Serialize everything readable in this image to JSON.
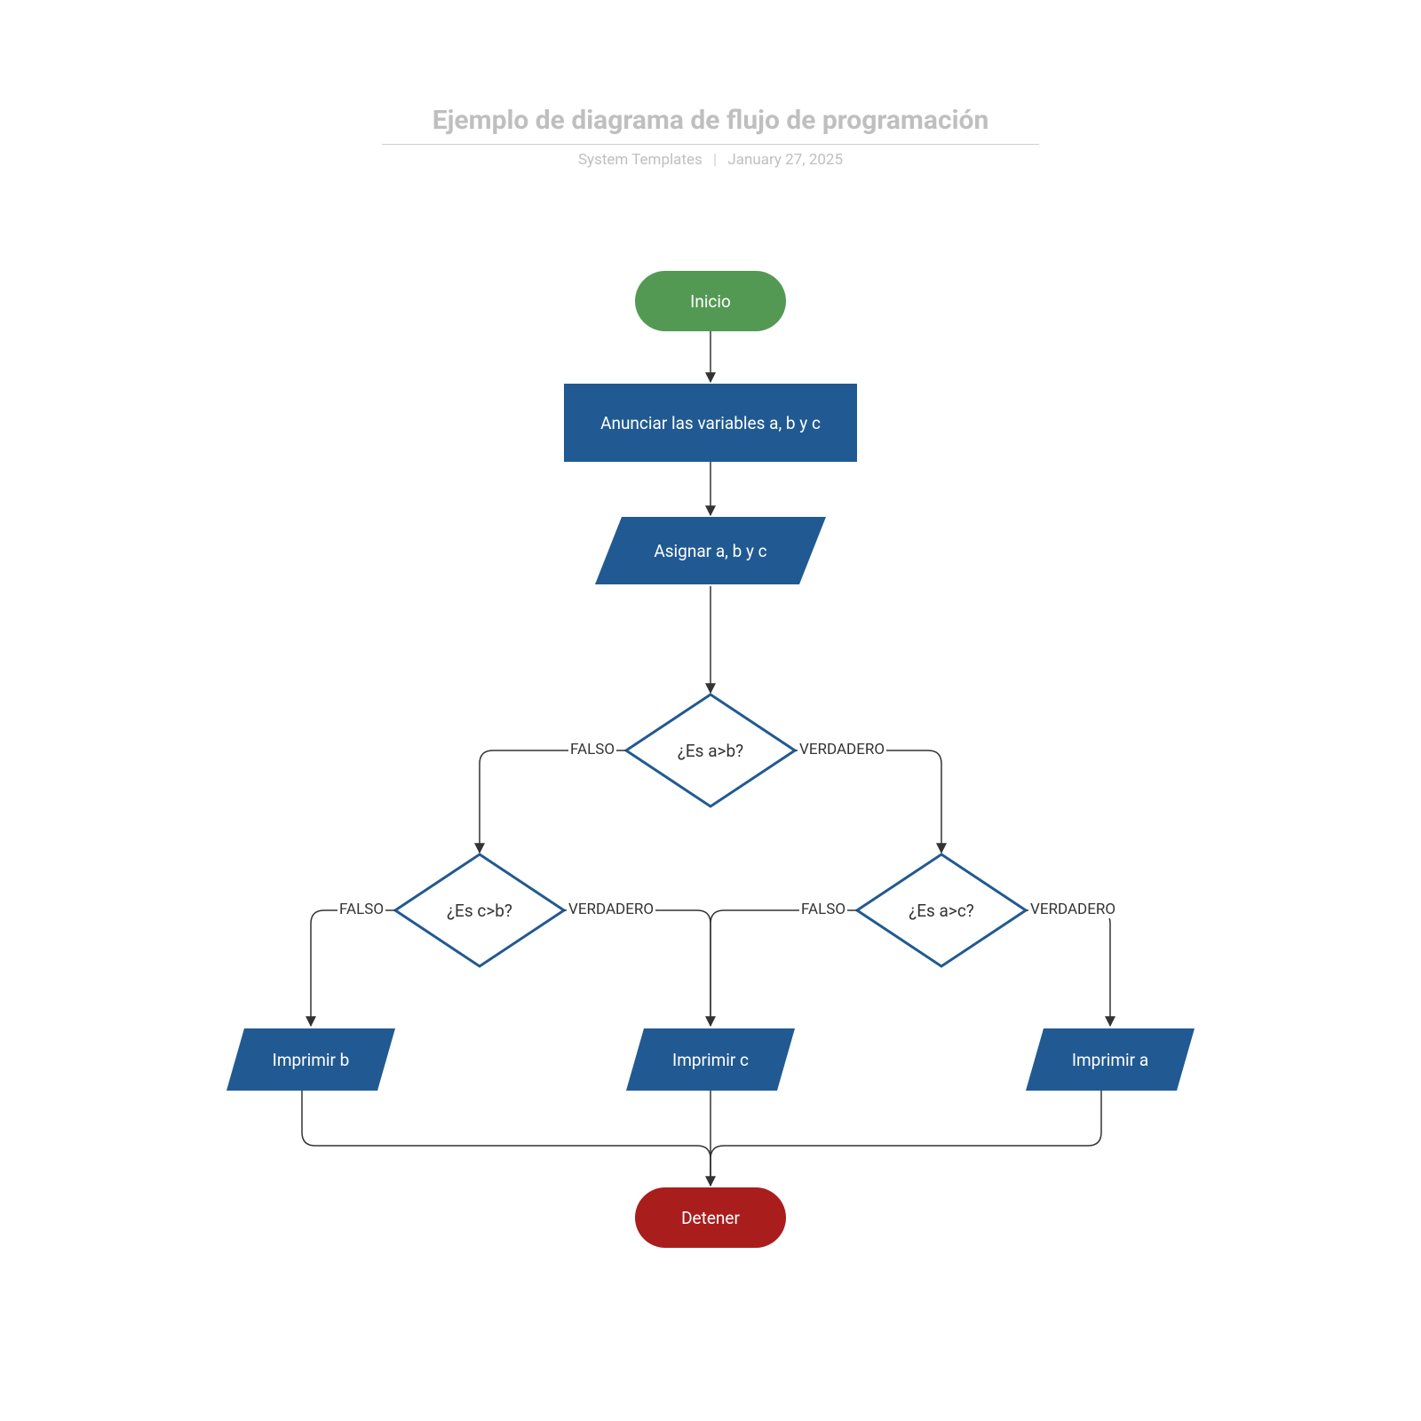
{
  "header": {
    "title": "Ejemplo de diagrama de flujo de programación",
    "meta_left": "System Templates",
    "meta_right": "January 27, 2025"
  },
  "nodes": {
    "start": "Inicio",
    "declare": "Anunciar las variables a, b y c",
    "assign": "Asignar a, b y c",
    "dec_ab": "¿Es a>b?",
    "dec_cb": "¿Es c>b?",
    "dec_ac": "¿Es a>c?",
    "print_b": "Imprimir b",
    "print_c": "Imprimir c",
    "print_a": "Imprimir a",
    "stop": "Detener"
  },
  "edgeLabels": {
    "false": "FALSO",
    "true": "VERDADERO"
  },
  "colors": {
    "start": "#539953",
    "process": "#215a92",
    "decisionStroke": "#215a92",
    "stop": "#a91d1d",
    "line": "#333333",
    "titleGrey": "#bfbfbf"
  }
}
